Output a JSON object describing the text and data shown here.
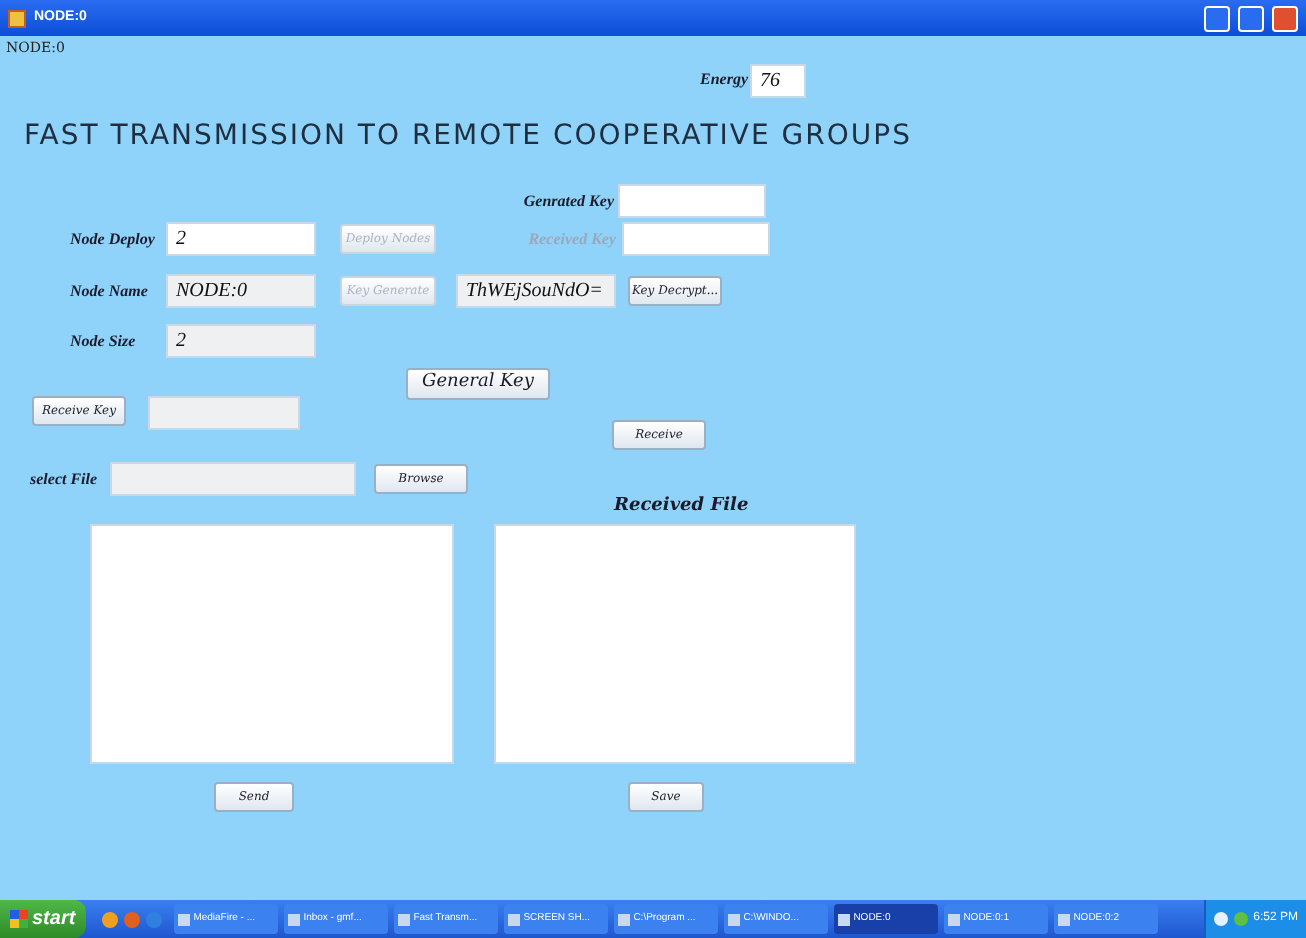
{
  "window": {
    "title": "NODE:0"
  },
  "node_label": "NODE:0",
  "energy": {
    "label": "Energy",
    "value": "76",
    "editable": true
  },
  "heading": "FAST TRANSMISSION TO REMOTE COOPERATIVE GROUPS",
  "generated_key": {
    "label": "Genrated Key",
    "editable": true,
    "disabled": false
  },
  "received_key": {
    "label": "Received Key",
    "editable": true,
    "disabled": true
  },
  "node_deploy": {
    "label": "Node Deploy",
    "value": "2",
    "editable": true
  },
  "deploy_button": {
    "label": "Deploy Nodes",
    "disabled": true
  },
  "node_name": {
    "label": "Node Name",
    "value": "NODE:0",
    "editable": false
  },
  "node_size": {
    "label": "Node Size",
    "value": "2",
    "editable": false
  },
  "key_generate_button": {
    "label": "Key Generate",
    "disabled": true
  },
  "key_field": {
    "value": "ThWEjSouNdO=",
    "editable": false
  },
  "key_decrypt_button": {
    "label": "Key Decrypt...",
    "disabled": false
  },
  "general_key_button": {
    "label": "General Key",
    "disabled": false
  },
  "receive_key_button": {
    "label": "Receive Key",
    "disabled": false
  },
  "receive_key_field": {
    "editable": false
  },
  "receive_button": {
    "label": "Receive",
    "disabled": false
  },
  "select_file": {
    "label": "select File",
    "editable": false
  },
  "browse_button": {
    "label": "Browse",
    "disabled": false
  },
  "received_file_label": "Received File",
  "send_button": {
    "label": "Send",
    "disabled": false
  },
  "save_button": {
    "label": "Save",
    "disabled": false
  },
  "taskbar": {
    "start": "start",
    "items": [
      {
        "label": "MediaFire - ...",
        "selected": false
      },
      {
        "label": "Inbox - gmf...",
        "selected": false
      },
      {
        "label": "Fast Transm...",
        "selected": false
      },
      {
        "label": "SCREEN SH...",
        "selected": false
      },
      {
        "label": "C:\\Program ...",
        "selected": false
      },
      {
        "label": "C:\\WINDO...",
        "selected": false
      },
      {
        "label": "NODE:0",
        "selected": true
      },
      {
        "label": "NODE:0:1",
        "selected": false
      },
      {
        "label": "NODE:0:2",
        "selected": false
      }
    ],
    "clock": "6:52 PM"
  }
}
